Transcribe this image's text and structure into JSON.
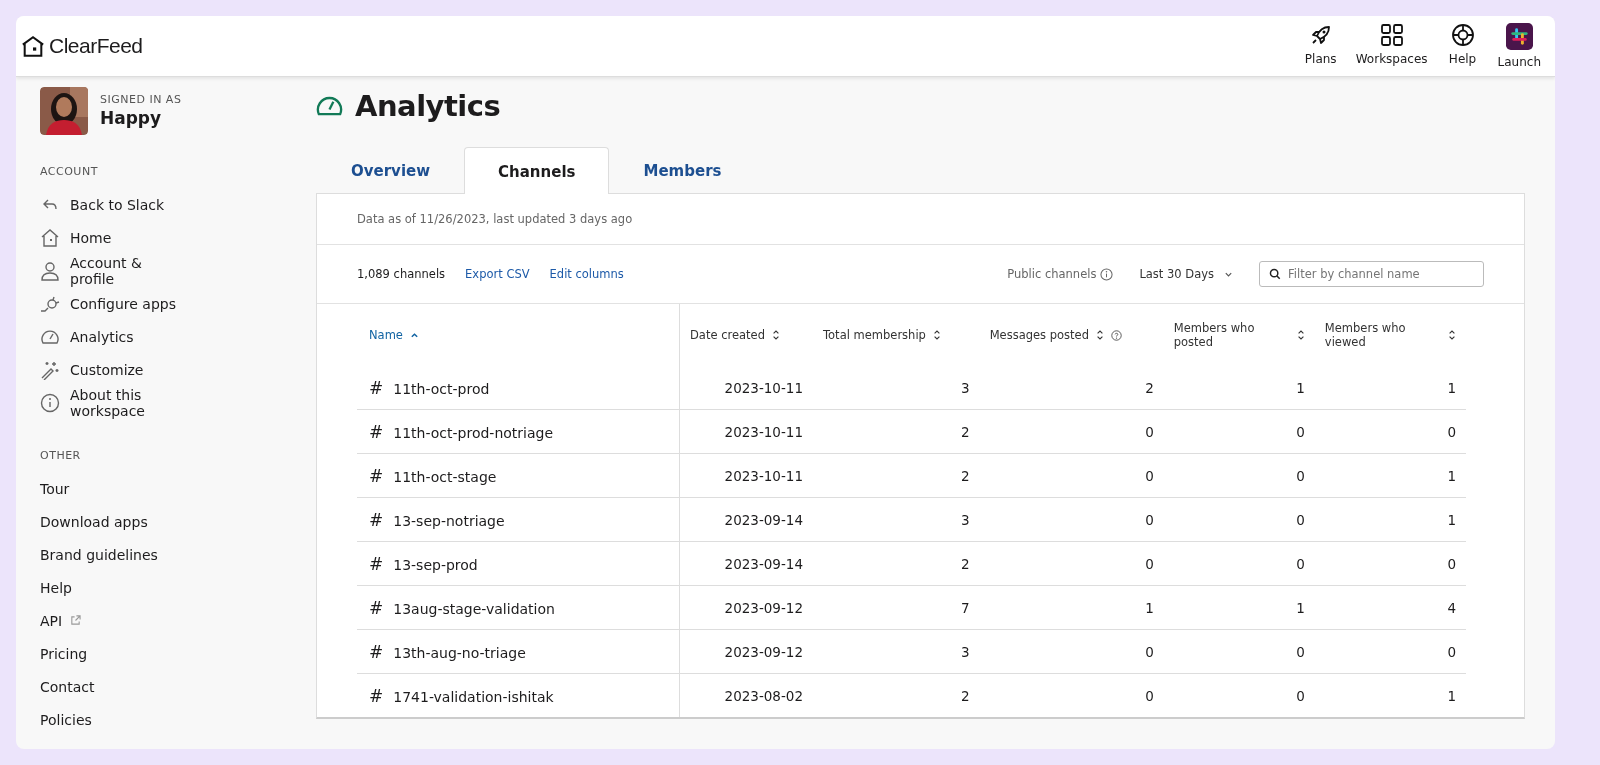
{
  "brand": {
    "name": "ClearFeed"
  },
  "top_nav": [
    {
      "label": "Plans",
      "kind": "rocket"
    },
    {
      "label": "Workspaces",
      "kind": "grid"
    },
    {
      "label": "Help",
      "kind": "lifebuoy"
    },
    {
      "label": "Launch",
      "kind": "app"
    }
  ],
  "user": {
    "caption": "SIGNED IN AS",
    "name": "Happy"
  },
  "sidebar": {
    "sections": [
      {
        "title": "ACCOUNT",
        "items": [
          {
            "label": "Back to Slack",
            "kind": "back"
          },
          {
            "label": "Home",
            "kind": "home"
          },
          {
            "label": "Account & profile",
            "kind": "person"
          },
          {
            "label": "Configure apps",
            "kind": "plug"
          },
          {
            "label": "Analytics",
            "kind": "gauge"
          },
          {
            "label": "Customize",
            "kind": "wand"
          },
          {
            "label": "About this workspace",
            "kind": "info"
          }
        ]
      },
      {
        "title": "OTHER",
        "items": [
          {
            "label": "Tour",
            "external": false
          },
          {
            "label": "Download apps",
            "external": false
          },
          {
            "label": "Brand guidelines",
            "external": false
          },
          {
            "label": "Help",
            "external": false
          },
          {
            "label": "API",
            "external": true
          },
          {
            "label": "Pricing",
            "external": false
          },
          {
            "label": "Contact",
            "external": false
          },
          {
            "label": "Policies",
            "external": false
          }
        ]
      }
    ]
  },
  "page": {
    "title": "Analytics"
  },
  "tabs": [
    {
      "label": "Overview",
      "selected": false
    },
    {
      "label": "Channels",
      "selected": true
    },
    {
      "label": "Members",
      "selected": false
    }
  ],
  "data_note": "Data as of 11/26/2023, last updated 3 days ago",
  "toolbar": {
    "count": "1,089 channels",
    "links": [
      "Export CSV",
      "Edit columns"
    ],
    "filter_label": "Public channels",
    "range": "Last 30 Days",
    "search": {
      "placeholder": "Filter by channel name"
    }
  },
  "table": {
    "columns": [
      {
        "label": "Name",
        "selected": true,
        "help": false
      },
      {
        "label": "Date created",
        "selected": false,
        "help": false
      },
      {
        "label": "Total membership",
        "selected": false,
        "help": false
      },
      {
        "label": "Messages posted",
        "selected": false,
        "help": true
      },
      {
        "label": "Members who posted",
        "selected": false,
        "help": false
      },
      {
        "label": "Members who viewed",
        "selected": false,
        "help": false
      }
    ],
    "rows": [
      {
        "symbol": "#",
        "cells": [
          "11th-oct-prod",
          "2023-10-11",
          "3",
          "2",
          "1",
          "1"
        ]
      },
      {
        "symbol": "#",
        "cells": [
          "11th-oct-prod-notriage",
          "2023-10-11",
          "2",
          "0",
          "0",
          "0"
        ]
      },
      {
        "symbol": "#",
        "cells": [
          "11th-oct-stage",
          "2023-10-11",
          "2",
          "0",
          "0",
          "1"
        ]
      },
      {
        "symbol": "#",
        "cells": [
          "13-sep-notriage",
          "2023-09-14",
          "3",
          "0",
          "0",
          "1"
        ]
      },
      {
        "symbol": "#",
        "cells": [
          "13-sep-prod",
          "2023-09-14",
          "2",
          "0",
          "0",
          "0"
        ]
      },
      {
        "symbol": "#",
        "cells": [
          "13aug-stage-validation",
          "2023-09-12",
          "7",
          "1",
          "1",
          "4"
        ]
      },
      {
        "symbol": "#",
        "cells": [
          "13th-aug-no-triage",
          "2023-09-12",
          "3",
          "0",
          "0",
          "0"
        ]
      },
      {
        "symbol": "#",
        "cells": [
          "1741-validation-ishitak",
          "2023-08-02",
          "2",
          "0",
          "0",
          "1"
        ]
      }
    ]
  }
}
